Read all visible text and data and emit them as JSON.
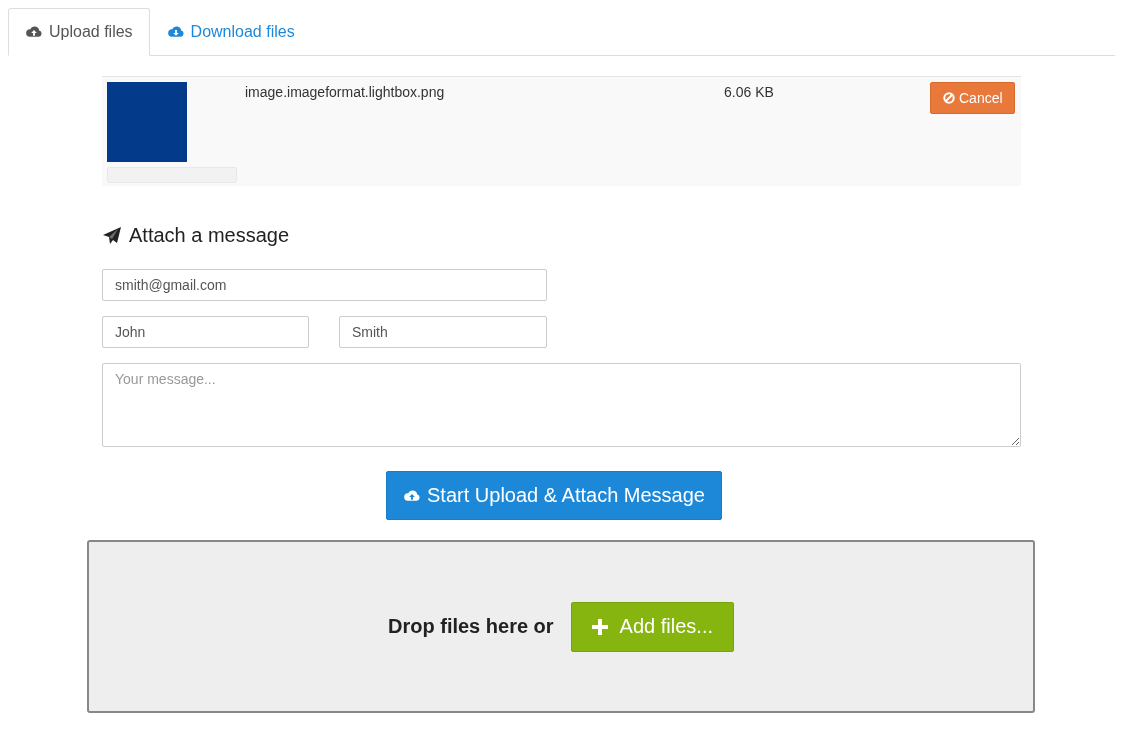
{
  "tabs": [
    {
      "label": "Upload files",
      "kind": "upload",
      "selected": true
    },
    {
      "label": "Download files",
      "kind": "download",
      "selected": false
    }
  ],
  "files": [
    {
      "name": "image.imageformat.lightbox.png",
      "size": "6.06 KB",
      "level": 0,
      "cancel_label": "Cancel"
    }
  ],
  "message": {
    "heading": "Attach a message",
    "email": {
      "value": "smith@gmail.com"
    },
    "first_name": {
      "value": "John"
    },
    "last_name": {
      "value": "Smith"
    },
    "body": {
      "placeholder": "Your message..."
    }
  },
  "submit_button": "Start Upload & Attach Message",
  "dropzone": {
    "text": "Drop files here or",
    "button": "Add files..."
  }
}
